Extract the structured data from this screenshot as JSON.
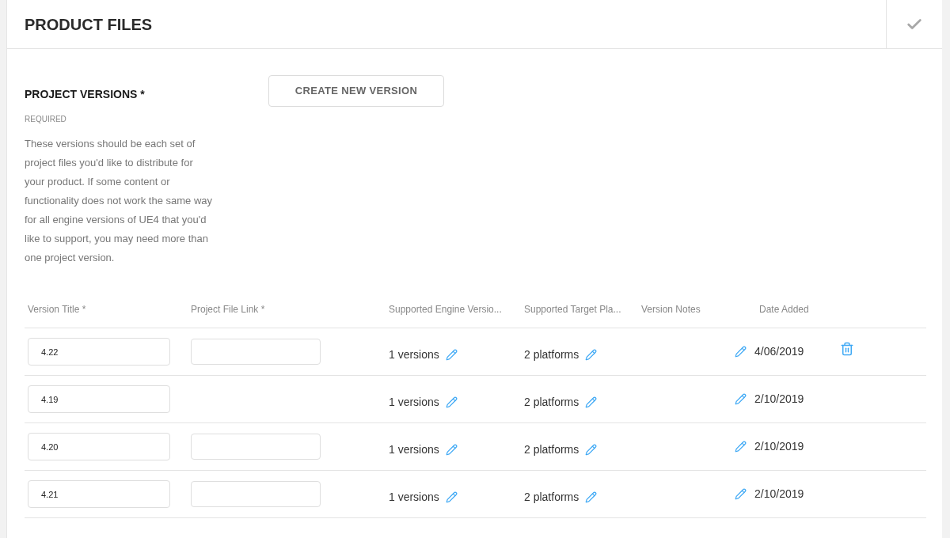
{
  "panel": {
    "title": "PRODUCT FILES",
    "complete": true
  },
  "section": {
    "title": "PROJECT VERSIONS *",
    "required_label": "REQUIRED",
    "description": "These versions should be each set of project files you'd like to distribute for your product. If some content or functionality does not work the same way for all engine versions of UE4 that you'd like to support, you may need more than one project version.",
    "create_button": "CREATE NEW VERSION"
  },
  "table": {
    "columns": [
      "Version Title *",
      "Project File Link *",
      "Supported Engine Versio...",
      "Supported Target Pla...",
      "Version Notes",
      "Date Added"
    ],
    "rows": [
      {
        "version_title": "4.22",
        "link_field": true,
        "engine_versions": "1 versions",
        "platforms": "2 platforms",
        "date_added": "4/06/2019",
        "deletable": true
      },
      {
        "version_title": "4.19",
        "link_field": false,
        "engine_versions": "1 versions",
        "platforms": "2 platforms",
        "date_added": "2/10/2019",
        "deletable": false
      },
      {
        "version_title": "4.20",
        "link_field": true,
        "engine_versions": "1 versions",
        "platforms": "2 platforms",
        "date_added": "2/10/2019",
        "deletable": false
      },
      {
        "version_title": "4.21",
        "link_field": true,
        "engine_versions": "1 versions",
        "platforms": "2 platforms",
        "date_added": "2/10/2019",
        "deletable": false
      }
    ]
  }
}
